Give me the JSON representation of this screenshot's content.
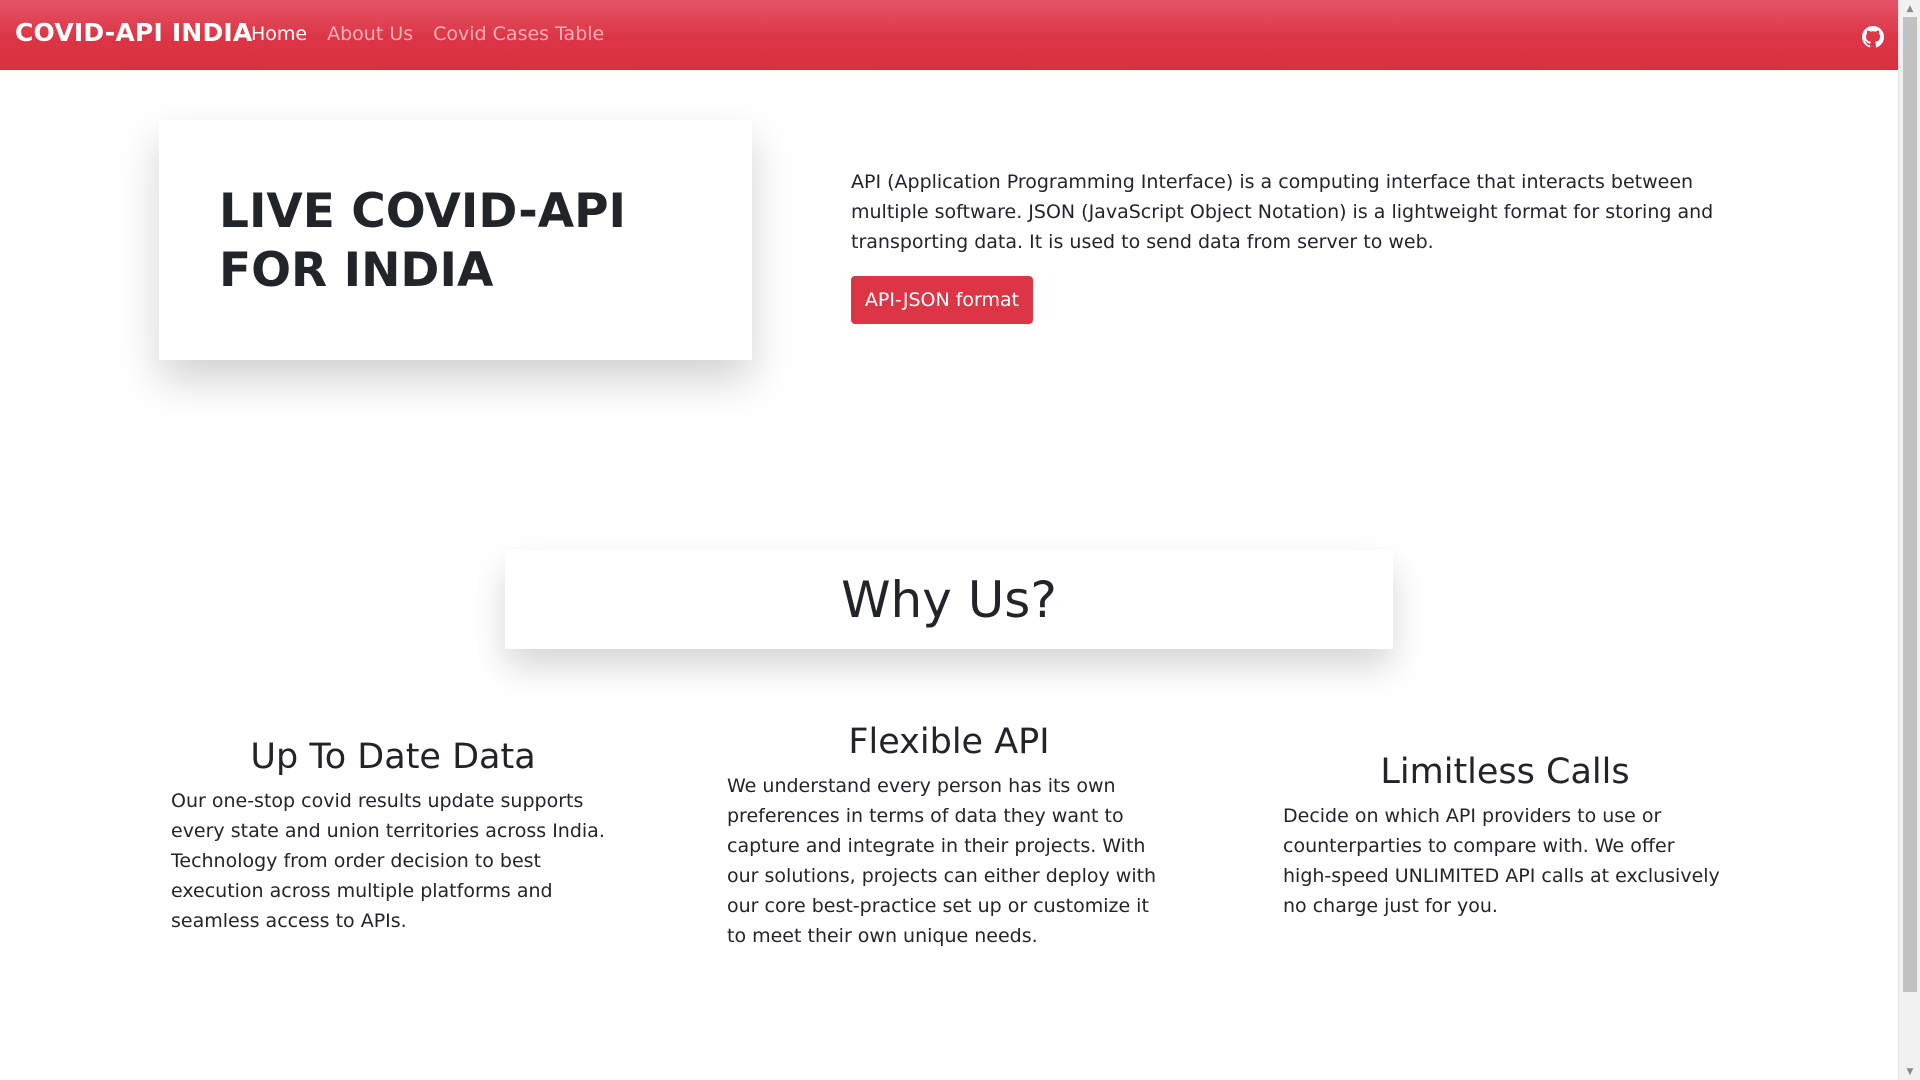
{
  "navbar": {
    "brand": "COVID-API INDIA",
    "links": [
      {
        "label": "Home",
        "active": true
      },
      {
        "label": "About Us",
        "active": false
      },
      {
        "label": "Covid Cases Table",
        "active": false
      }
    ],
    "icon": "github-icon",
    "color": "#dc3545"
  },
  "hero": {
    "title": "LIVE COVID-API FOR INDIA",
    "description": "API (Application Programming Interface) is a computing interface that interacts between multiple software. JSON (JavaScript Object Notation) is a lightweight format for storing and transporting data. It is used to send data from server to web.",
    "button_label": "API-JSON format"
  },
  "why": {
    "title": "Why Us?"
  },
  "features": [
    {
      "title": "Up To Date Data",
      "text": "Our one-stop covid results update supports every state and union territories across India. Technology from order decision to best execution across multiple platforms and seamless access to APIs."
    },
    {
      "title": "Flexible API",
      "text": "We understand every person has its own preferences in terms of data they want to capture and integrate in their projects. With our solutions, projects can either deploy with our core best-practice set up or customize it to meet their own unique needs."
    },
    {
      "title": "Limitless Calls",
      "text": "Decide on which API providers to use or counterparties to compare with. We offer high-speed UNLIMITED API calls at exclusively no charge just for you."
    }
  ]
}
